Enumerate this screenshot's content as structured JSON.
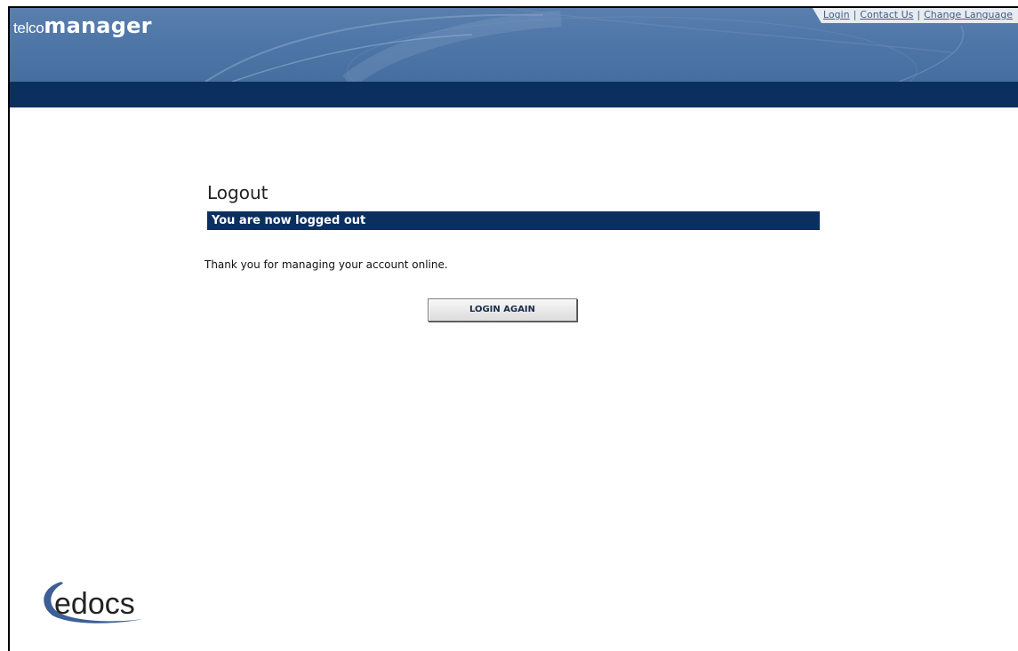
{
  "brand": {
    "prefix": "telco",
    "name": "manager"
  },
  "top_links": {
    "login": "Login",
    "contact_us": "Contact Us",
    "change_language": "Change Language",
    "separator": "|"
  },
  "page": {
    "title": "Logout",
    "status": "You are now logged out",
    "message": "Thank you for managing your account online.",
    "login_again_label": "LOGIN AGAIN"
  },
  "footer_logo": {
    "text": "edocs"
  },
  "colors": {
    "header_blue": "#4f77a8",
    "navy": "#0b2f5f",
    "link": "#3e5d8a"
  }
}
